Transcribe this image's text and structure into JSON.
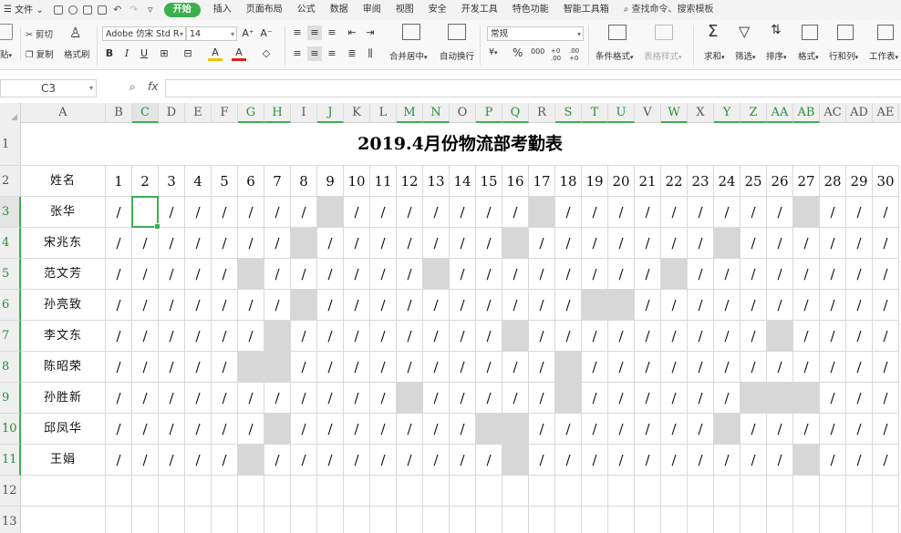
{
  "menubar": {
    "file": "文件",
    "items": [
      "开始",
      "插入",
      "页面布局",
      "公式",
      "数据",
      "审阅",
      "视图",
      "安全",
      "开发工具",
      "特色功能",
      "智能工具箱"
    ],
    "active": "开始",
    "search": "查找命令、搜索模板"
  },
  "ribbon": {
    "paste_partial": "贴",
    "cut": "剪切",
    "copy": "复制",
    "format_painter": "格式刷",
    "font_name": "Adobe 仿宋 Std R",
    "font_size": "14",
    "bold": "B",
    "italic": "I",
    "underline": "U",
    "grow_font": "A⁺",
    "shrink_font": "A⁻",
    "font_color_letter": "A",
    "highlight_letter": "A",
    "merge_center": "合并居中",
    "wrap_text": "自动换行",
    "number_format": "常规",
    "currency": "¥",
    "percent": "%",
    "thousands": "000",
    "inc_decimal": "+0 .00",
    "dec_decimal": ".00 +0",
    "cond_format": "条件格式",
    "table_style": "表格样式",
    "sum": "求和",
    "filter": "筛选",
    "sort": "排序",
    "format": "格式",
    "row_col": "行和列",
    "worksheet": "工作表"
  },
  "formula_bar": {
    "name_box": "C3",
    "fx": "fx",
    "value": ""
  },
  "sheet": {
    "columns": [
      "A",
      "B",
      "C",
      "D",
      "E",
      "F",
      "G",
      "H",
      "I",
      "J",
      "K",
      "L",
      "M",
      "N",
      "O",
      "P",
      "Q",
      "R",
      "S",
      "T",
      "U",
      "V",
      "W",
      "X",
      "Y",
      "Z",
      "AA",
      "AB",
      "AC",
      "AD",
      "AE"
    ],
    "highlighted_columns": [
      "C",
      "G",
      "H",
      "J",
      "M",
      "N",
      "P",
      "Q",
      "S",
      "T",
      "U",
      "W",
      "Y",
      "Z",
      "AA",
      "AB"
    ],
    "selected_column": "C",
    "row_numbers": [
      "1",
      "2",
      "3",
      "4",
      "5",
      "6",
      "7",
      "8",
      "9",
      "10",
      "11",
      "12",
      "13"
    ],
    "highlighted_rows": [
      "3",
      "4",
      "5",
      "6",
      "7",
      "8",
      "9",
      "10",
      "11"
    ],
    "selected_row": "3",
    "active_cell": "C3",
    "title": "2019.4月份物流部考勤表",
    "name_header": "姓名",
    "days": [
      "1",
      "2",
      "3",
      "4",
      "5",
      "6",
      "7",
      "8",
      "9",
      "10",
      "11",
      "12",
      "13",
      "14",
      "15",
      "16",
      "17",
      "18",
      "19",
      "20",
      "21",
      "22",
      "23",
      "24",
      "25",
      "26",
      "27",
      "28",
      "29",
      "30"
    ],
    "present_mark": "/",
    "employees": [
      {
        "name": "张华",
        "absent_days": [
          9,
          17,
          27
        ],
        "blank_days": [
          2
        ]
      },
      {
        "name": "宋兆东",
        "absent_days": [
          8,
          16,
          24
        ],
        "blank_days": []
      },
      {
        "name": "范文芳",
        "absent_days": [
          6,
          13,
          22
        ],
        "blank_days": []
      },
      {
        "name": "孙亮致",
        "absent_days": [
          8,
          19,
          20
        ],
        "blank_days": []
      },
      {
        "name": "李文东",
        "absent_days": [
          7,
          16,
          26
        ],
        "blank_days": []
      },
      {
        "name": "陈昭荣",
        "absent_days": [
          6,
          7,
          18
        ],
        "blank_days": []
      },
      {
        "name": "孙胜新",
        "absent_days": [
          12,
          18,
          25,
          26,
          27
        ],
        "blank_days": []
      },
      {
        "name": "邱凤华",
        "absent_days": [
          7,
          15,
          16,
          24
        ],
        "blank_days": []
      },
      {
        "name": "王娟",
        "absent_days": [
          6,
          16,
          27
        ],
        "blank_days": []
      }
    ]
  },
  "colors": {
    "accent": "#3caf4f",
    "absent_fill": "#d7d7d7"
  }
}
